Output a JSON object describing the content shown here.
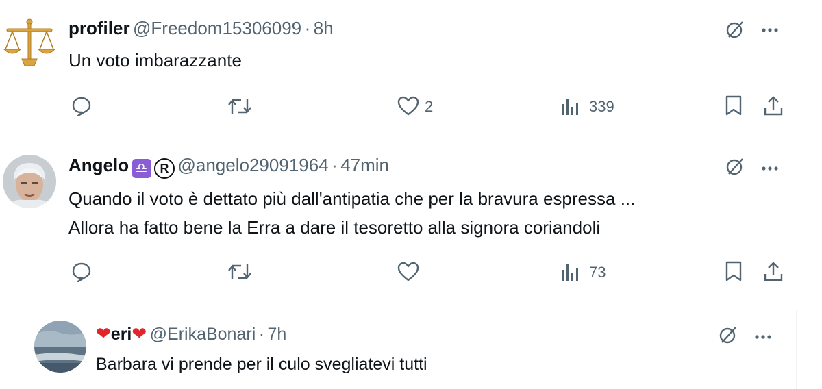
{
  "tweets": [
    {
      "name": "profiler",
      "handle": "@Freedom15306099",
      "sep": "·",
      "time": "8h",
      "text": "Un voto imbarazzante",
      "likes": "2",
      "views": "339"
    },
    {
      "name": "Angelo",
      "zodiac": "♎",
      "reg": "R",
      "handle": "@angelo29091964",
      "sep": "·",
      "time": "47min",
      "text_line1": "Quando il voto è dettato più dall'antipatia che per la bravura espressa ...",
      "text_line2": "Allora ha fatto bene la Erra a dare il tesoretto alla signora coriandoli",
      "likes": "",
      "views": "73"
    },
    {
      "name_pre": "❤",
      "name": "eri",
      "name_post": "❤",
      "handle": "@ErikaBonari",
      "sep": "·",
      "time": "7h",
      "text": "Barbara vi prende per il culo svegliatevi tutti"
    }
  ],
  "icons": {
    "grok": "grok-icon",
    "more": "more-icon",
    "reply": "reply-icon",
    "retweet": "retweet-icon",
    "like": "heart-icon",
    "views": "views-icon",
    "bookmark": "bookmark-icon",
    "share": "share-icon"
  }
}
